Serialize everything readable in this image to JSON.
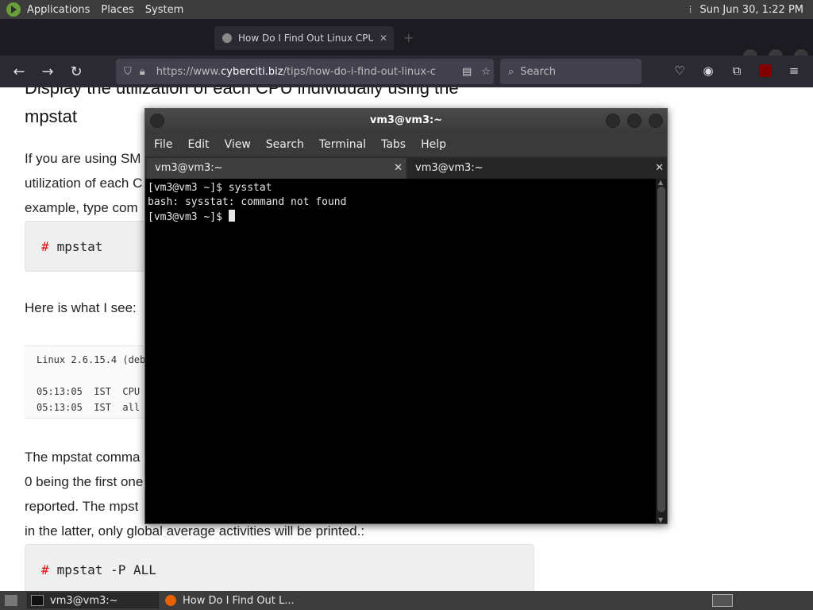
{
  "top_panel": {
    "menus": [
      "Applications",
      "Places",
      "System"
    ],
    "clock": "Sun Jun 30,  1:22 PM"
  },
  "browser": {
    "tab_title": "How Do I Find Out Linux CPU",
    "url_prefix": "https://www.",
    "url_domain": "cyberciti.biz",
    "url_path": "/tips/how-do-i-find-out-linux-c",
    "search_placeholder": "Search"
  },
  "page": {
    "heading_line1": "Display the utilization of each CPU individually using the",
    "heading_line2": "mpstat",
    "para1_line1": "If you are using SM",
    "para1_line2": "utilization of each C",
    "para1_line3": "example, type com",
    "code1": "mpstat",
    "here_text": "Here is what I see:",
    "output_lines": [
      "Linux 2.6.15.4 (deb",
      "05:13:05  IST  CPU",
      "05:13:05  IST  all"
    ],
    "para2_line1": "The mpstat comma",
    "para2_line2": "0 being the first one",
    "para2_line3": "reported. The mpst",
    "para2_line4": "in the latter, only global average activities will be printed.:",
    "code2": "mpstat -P ALL",
    "code_prompt": "#"
  },
  "terminal": {
    "title": "vm3@vm3:~",
    "menu": [
      "File",
      "Edit",
      "View",
      "Search",
      "Terminal",
      "Tabs",
      "Help"
    ],
    "tabs": [
      "vm3@vm3:~",
      "vm3@vm3:~"
    ],
    "lines": [
      "[vm3@vm3 ~]$ sysstat",
      "bash: sysstat: command not found",
      "[vm3@vm3 ~]$ "
    ]
  },
  "taskbar": {
    "items": [
      "vm3@vm3:~",
      "How Do I Find Out L..."
    ]
  },
  "colors": {
    "code_prompt": "#dd1111",
    "terminal_bg": "#000000",
    "panel_bg": "#3c3c3c"
  }
}
